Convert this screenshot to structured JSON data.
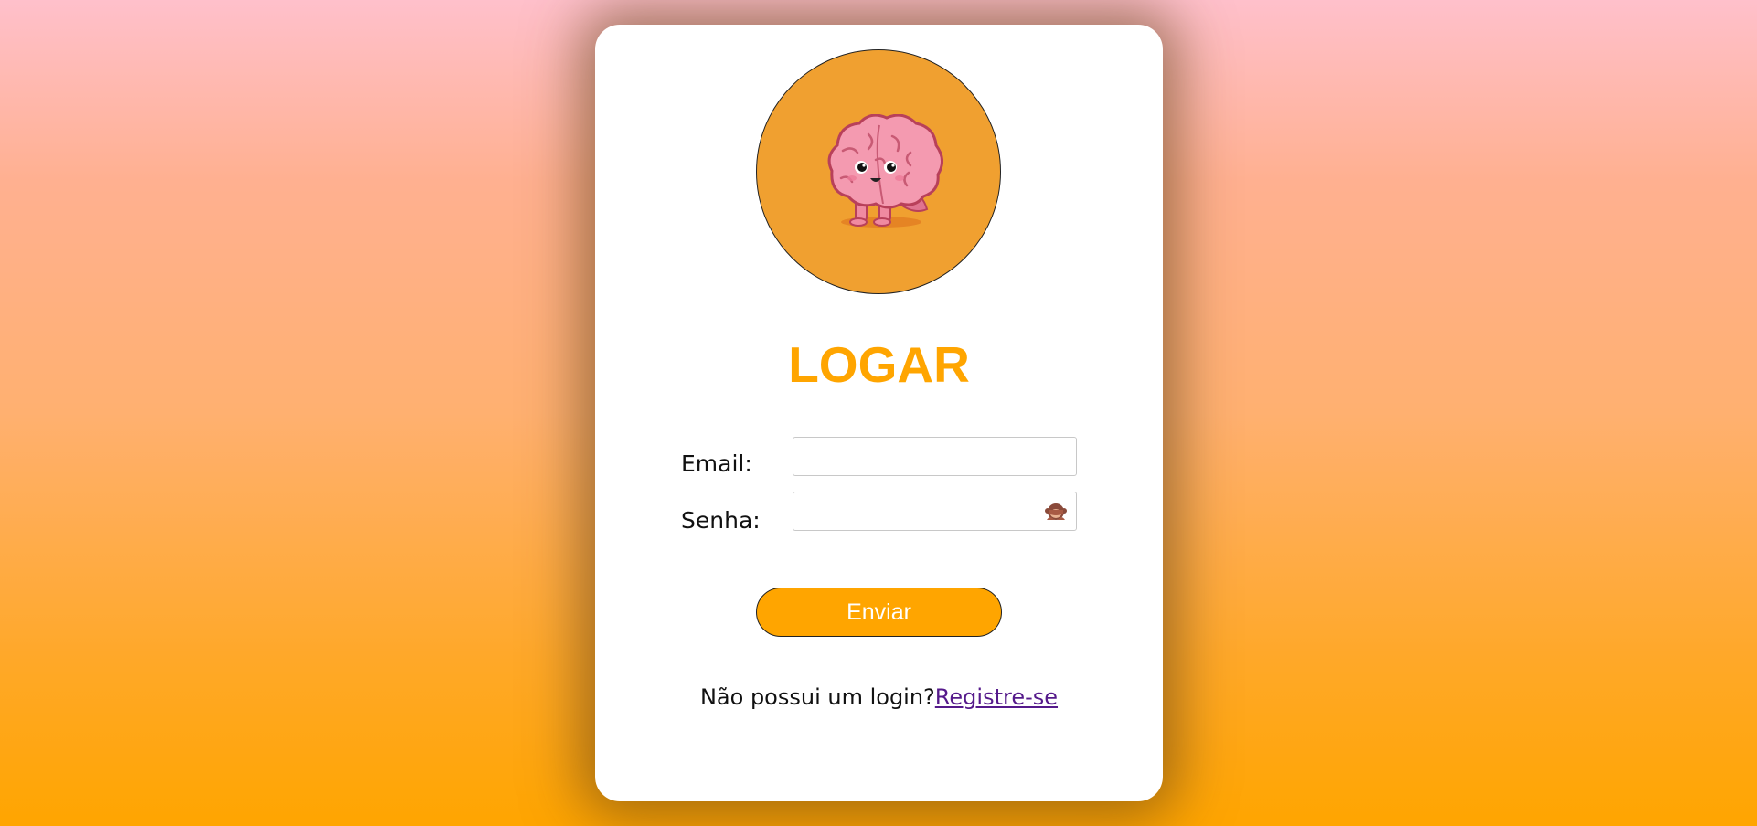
{
  "login": {
    "title": "LOGAR",
    "email_label": "Email:",
    "email_value": "",
    "password_label": "Senha:",
    "password_value": "",
    "submit_label": "Enviar",
    "register_prompt": "Não possui um login?",
    "register_link": "Registre-se"
  },
  "icons": {
    "avatar": "brain-mascot-icon",
    "password_toggle": "see-no-evil-monkey-icon"
  },
  "colors": {
    "accent": "#ffa500",
    "avatar_bg": "#f0a030",
    "link": "#551a8b",
    "card_bg": "#ffffff",
    "gradient_top": "#ffc0cb",
    "gradient_bottom": "#ffa500"
  }
}
